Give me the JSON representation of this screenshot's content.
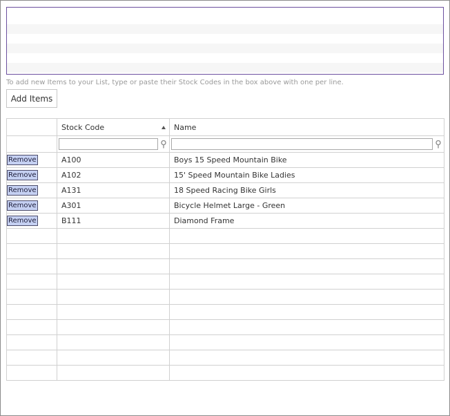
{
  "form": {
    "codes_value": "",
    "help_text": "To add new Items to your List, type or paste their Stock Codes in the box above with one per line.",
    "add_button_label": "Add Items"
  },
  "grid": {
    "columns": [
      {
        "label": ""
      },
      {
        "label": "Stock Code",
        "sorted": "ascending"
      },
      {
        "label": "Name"
      }
    ],
    "filter_stock_code": "",
    "filter_name": "",
    "remove_label": "Remove",
    "rows": [
      {
        "code": "A100",
        "name": "Boys 15 Speed Mountain Bike"
      },
      {
        "code": "A102",
        "name": "15' Speed Mountain Bike Ladies"
      },
      {
        "code": "A131",
        "name": "18 Speed Racing Bike Girls"
      },
      {
        "code": "A301",
        "name": "Bicycle Helmet Large - Green"
      },
      {
        "code": "B111",
        "name": "Diamond Frame"
      }
    ],
    "empty_rows": 10
  },
  "icons": {
    "filter": "filter-pin-icon",
    "sort": "sort-ascending-icon"
  },
  "colors": {
    "textarea_border": "#6b4f9e",
    "remove_button_bg": "#c5d0f2",
    "grid_border": "#d0d0d0",
    "help_text": "#9a9a9a"
  }
}
